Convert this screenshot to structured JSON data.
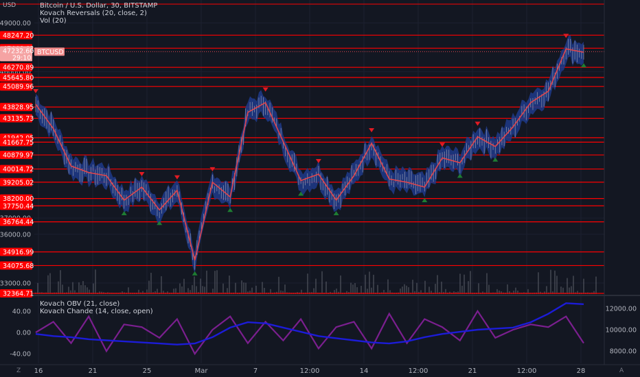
{
  "header": {
    "currency": "USD",
    "title": "Bitcoin / U.S. Dollar, 30, BITSTAMP",
    "indicator_1": "Kovach Reversals (20, close, 2)",
    "indicator_2": "Vol (20)"
  },
  "lower_pane": {
    "indicator_1": "Kovach OBV (21, close)",
    "indicator_2": "Kovach Chande (14, close, open)"
  },
  "corner_left": "Z",
  "corner_right": "A",
  "colors": {
    "background": "#131722",
    "level_line": "#ff0000",
    "candle_up": "#b2b5be",
    "trend_line": "#e0464d",
    "band": "#1e3a8a",
    "buy_signal": "#1e7d32",
    "sell_signal": "#e21b23",
    "obv_line": "#1c1cd8",
    "chande_line": "#7b1f8f"
  },
  "current_price": {
    "symbol": "BTCUSD",
    "value": "47232.60",
    "countdown": "29:10"
  },
  "chart_data": [
    {
      "type": "line",
      "title": "Bitcoin / U.S. Dollar, 30, BITSTAMP",
      "ylim": [
        32364.71,
        50200
      ],
      "y_axis_ticks": [
        "49000.00",
        "46000.00",
        "37000.00",
        "36000.00",
        "33000.00"
      ],
      "horizontal_levels": [
        "48247.20",
        "47446.62",
        "46270.89",
        "45645.80",
        "45089.96",
        "43828.95",
        "43135.73",
        "41942.05",
        "41667.75",
        "40879.97",
        "40014.72",
        "39205.02",
        "38200.00",
        "37750.44",
        "36764.44",
        "34916.99",
        "34075.68",
        "32364.71"
      ],
      "x_axis_ticks": [
        "16",
        "21",
        "25",
        "Mar",
        "7",
        "12:00",
        "14",
        "12:00",
        "21",
        "12:00",
        "28"
      ],
      "series": [
        {
          "name": "BTCUSD",
          "x": [
            "16",
            "",
            "",
            "",
            "",
            "21",
            "",
            "",
            "",
            "25",
            "",
            "",
            "Mar",
            "",
            "",
            "",
            "",
            "7",
            "",
            "12:00",
            "",
            "14",
            "",
            "12:00",
            "",
            "",
            "21",
            "",
            "12:00",
            "",
            "28",
            ""
          ],
          "values": [
            44000,
            42500,
            40200,
            39800,
            39600,
            38100,
            38900,
            37500,
            38700,
            34400,
            39200,
            38300,
            43500,
            44100,
            41700,
            39300,
            39700,
            38100,
            39600,
            41600,
            39400,
            39200,
            38900,
            40700,
            40400,
            42000,
            41400,
            42600,
            44100,
            44800,
            47400,
            47200
          ]
        }
      ]
    },
    {
      "type": "line",
      "title": "Kovach OBV (21, close) / Kovach Chande (14, close, open)",
      "ylim_left": [
        -60,
        60
      ],
      "left_ticks": [
        "40.00",
        "0.00",
        "-40.00"
      ],
      "right_ticks": [
        "12000.00",
        "10000.00",
        "8000.00"
      ],
      "series": [
        {
          "name": "Kovach OBV (21, close)",
          "values": [
            9600,
            9400,
            9300,
            9100,
            9000,
            8900,
            8800,
            8700,
            8600,
            8700,
            9300,
            10200,
            10700,
            10600,
            10200,
            9800,
            9400,
            9200,
            9000,
            8800,
            8700,
            8900,
            9300,
            9600,
            9800,
            10000,
            10100,
            10200,
            10700,
            11500,
            12500,
            12400
          ]
        },
        {
          "name": "Kovach Chande (14, close, open)",
          "values": [
            0,
            20,
            -20,
            30,
            -35,
            15,
            10,
            -10,
            25,
            -40,
            5,
            30,
            -20,
            20,
            -15,
            25,
            -30,
            10,
            20,
            -30,
            35,
            -20,
            25,
            10,
            -15,
            40,
            -10,
            5,
            15,
            10,
            30,
            -20
          ]
        }
      ]
    }
  ]
}
